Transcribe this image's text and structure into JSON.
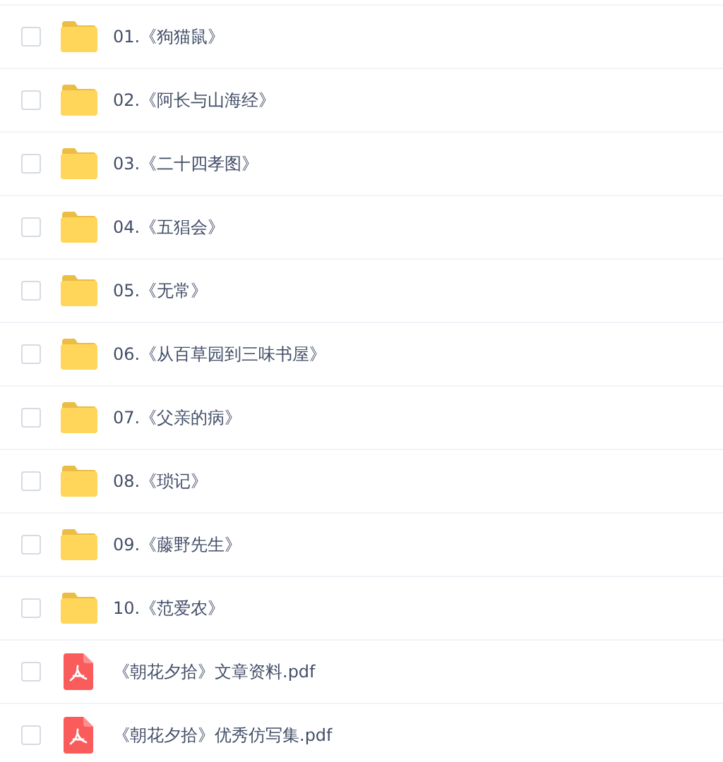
{
  "files": [
    {
      "kind": "folder",
      "name": "01.《狗猫鼠》",
      "checked": false
    },
    {
      "kind": "folder",
      "name": "02.《阿长与山海经》",
      "checked": false
    },
    {
      "kind": "folder",
      "name": "03.《二十四孝图》",
      "checked": false
    },
    {
      "kind": "folder",
      "name": "04.《五猖会》",
      "checked": false
    },
    {
      "kind": "folder",
      "name": "05.《无常》",
      "checked": false
    },
    {
      "kind": "folder",
      "name": "06.《从百草园到三味书屋》",
      "checked": false
    },
    {
      "kind": "folder",
      "name": "07.《父亲的病》",
      "checked": false
    },
    {
      "kind": "folder",
      "name": "08.《琐记》",
      "checked": false
    },
    {
      "kind": "folder",
      "name": "09.《藤野先生》",
      "checked": false
    },
    {
      "kind": "folder",
      "name": "10.《范爱农》",
      "checked": false
    },
    {
      "kind": "pdf",
      "name": "《朝花夕拾》文章资料.pdf",
      "checked": false
    },
    {
      "kind": "pdf",
      "name": "《朝花夕拾》优秀仿写集.pdf",
      "checked": false
    }
  ]
}
